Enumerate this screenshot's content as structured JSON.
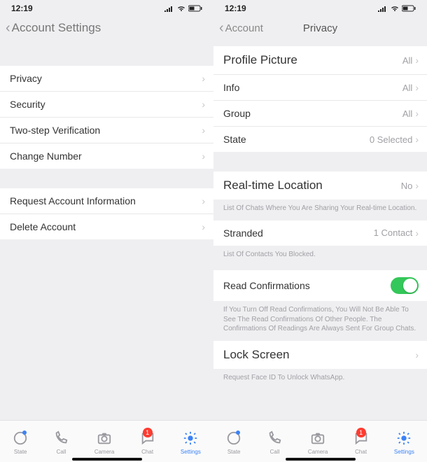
{
  "status": {
    "time": "12:19"
  },
  "left": {
    "nav_title": "Account Settings",
    "rows1": [
      {
        "label": "Privacy"
      },
      {
        "label": "Security"
      },
      {
        "label": "Two-step Verification"
      },
      {
        "label": "Change Number"
      }
    ],
    "rows2": [
      {
        "label": "Request Account Information"
      },
      {
        "label": "Delete Account"
      }
    ]
  },
  "right": {
    "nav_back": "Account",
    "nav_title": "Privacy",
    "rows1": [
      {
        "label": "Profile Picture",
        "value": "All",
        "big": true
      },
      {
        "label": "Info",
        "value": "All"
      },
      {
        "label": "Group",
        "value": "All"
      },
      {
        "label": "State",
        "value": "0 Selected"
      }
    ],
    "loc_label": "Real-time Location",
    "loc_value": "No",
    "loc_caption": "List Of Chats Where You Are Sharing Your Real-time Location.",
    "stranded_label": "Stranded",
    "stranded_value": "1 Contact",
    "stranded_caption": "List Of Contacts You Blocked.",
    "read_label": "Read Confirmations",
    "read_caption": "If You Turn Off Read Confirmations, You Will Not Be Able To See The Read Confirmations Of Other People. The Confirmations Of Readings Are Always Sent For Group Chats.",
    "lock_label": "Lock Screen",
    "lock_caption": "Request Face ID To Unlock WhatsApp."
  },
  "tabs": [
    {
      "name": "state",
      "label": "State"
    },
    {
      "name": "call",
      "label": "Call"
    },
    {
      "name": "camera",
      "label": "Camera"
    },
    {
      "name": "chat",
      "label": "Chat",
      "badge": "1"
    },
    {
      "name": "settings",
      "label": "Settings",
      "active": true
    }
  ]
}
